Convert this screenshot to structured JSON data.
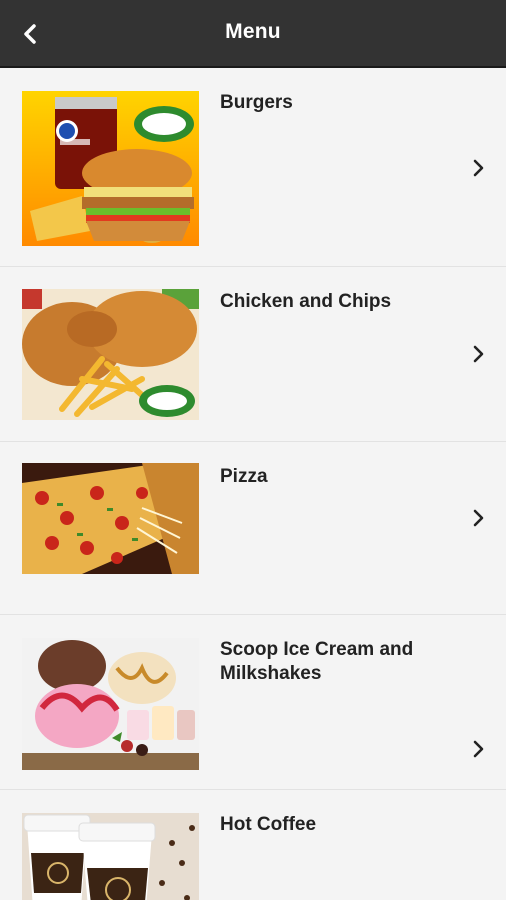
{
  "header": {
    "title": "Menu",
    "back_icon": "chevron-left-icon"
  },
  "menu": {
    "items": [
      {
        "label": "Burgers",
        "image": "burger-combo-photo",
        "chevron_icon": "chevron-right-icon"
      },
      {
        "label": "Chicken and Chips",
        "image": "fried-chicken-fries-photo",
        "chevron_icon": "chevron-right-icon"
      },
      {
        "label": "Pizza",
        "image": "pizza-slice-photo",
        "chevron_icon": "chevron-right-icon"
      },
      {
        "label": "Scoop Ice Cream and Milkshakes",
        "image": "ice-cream-scoops-photo",
        "chevron_icon": "chevron-right-icon"
      },
      {
        "label": "Hot Coffee",
        "image": "coffee-cups-photo",
        "chevron_icon": "chevron-right-icon"
      }
    ]
  },
  "colors": {
    "header_bg": "#333333",
    "header_text": "#ffffff",
    "list_bg": "#f4f4f4",
    "label_text": "#222222"
  }
}
